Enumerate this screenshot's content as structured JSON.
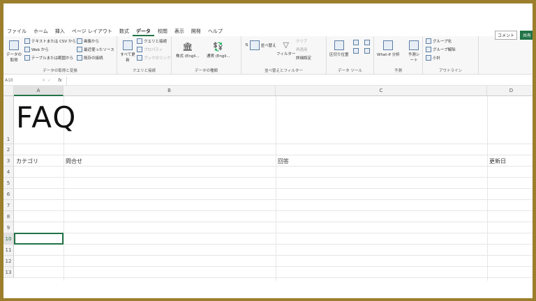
{
  "menu": [
    "ファイル",
    "ホーム",
    "挿入",
    "ページ レイアウト",
    "数式",
    "データ",
    "校閲",
    "表示",
    "開発",
    "ヘルプ"
  ],
  "menu_active": "データ",
  "header_buttons": {
    "comment": "コメント",
    "share": "共有"
  },
  "ribbon": {
    "get_data": {
      "label": "データの取得と変換",
      "big": "データの取得",
      "items": [
        "テキストまたは CSV から",
        "Web から",
        "テーブルまたは範囲から",
        "画像から",
        "最近使ったソース",
        "既存の接続"
      ]
    },
    "queries": {
      "label": "クエリと接続",
      "big": "すべて更新",
      "items": [
        "クエリと接続",
        "プロパティ",
        "ブックのリンク"
      ]
    },
    "data_types": {
      "label": "データの種類",
      "items": [
        "株式 (Engli...",
        "通貨 (Engli..."
      ]
    },
    "sort_filter": {
      "label": "並べ替えとフィルター",
      "items": [
        "並べ替え",
        "フィルター",
        "クリア",
        "再適用",
        "詳細設定"
      ]
    },
    "data_tools": {
      "label": "データ ツール",
      "items": [
        "区切り位置"
      ]
    },
    "forecast": {
      "label": "予測",
      "items": [
        "What-If 分析",
        "予測シート"
      ]
    },
    "outline": {
      "label": "アウトライン",
      "items": [
        "グループ化",
        "グループ解除",
        "小計"
      ]
    }
  },
  "formula_bar": {
    "name_box": "A10",
    "fx": "fx",
    "value": ""
  },
  "columns": [
    "A",
    "B",
    "C",
    "D"
  ],
  "rows": [
    "1",
    "2",
    "3",
    "4",
    "5",
    "6",
    "7",
    "8",
    "9",
    "10",
    "11",
    "12",
    "13"
  ],
  "cells": {
    "A1": "FAQ",
    "A3": "カテゴリ",
    "B3": "問合せ",
    "C3": "回答",
    "D3": "更新日"
  },
  "selected_cell": "A10",
  "colors": {
    "accent": "#217346",
    "frame": "#9c7f2c"
  }
}
